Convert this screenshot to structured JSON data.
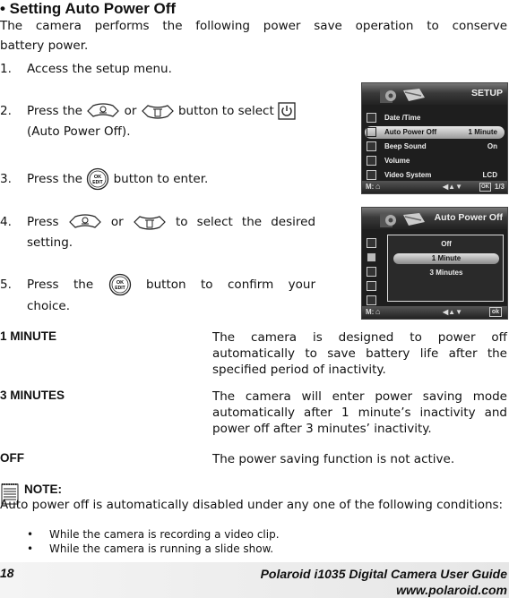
{
  "section": {
    "title": "• Setting Auto Power Off",
    "intro_line1": "The camera performs the following power save operation to conserve",
    "intro_line2": "battery power."
  },
  "steps": [
    {
      "num": "1.",
      "text": "Access the setup menu."
    },
    {
      "num": "2.",
      "text_a": "Press the",
      "text_b": "or",
      "text_c": "button to select",
      "text_d": "(Auto Power Off)."
    },
    {
      "num": "3.",
      "text_a": "Press the",
      "text_b": "button to enter."
    },
    {
      "num": "4.",
      "text_a": "Press",
      "text_b": "or",
      "text_c": "to select the desired",
      "text_d": "setting."
    },
    {
      "num": "5.",
      "text_a": "Press the",
      "text_b": "button to confirm your",
      "text_c": "choice."
    }
  ],
  "icons": {
    "up_button": "self-timer-up-button-icon",
    "down_button": "trash-down-button-icon",
    "power": "power-icon",
    "ok_edit": "ok-edit-button-icon",
    "ok_label": "OK",
    "edit_label": "EDIT"
  },
  "setup_screen": {
    "title": "SETUP",
    "rows": [
      {
        "label": "Date /Time",
        "value": ""
      },
      {
        "label": "Auto Power Off",
        "value": "1 Minute",
        "selected": true
      },
      {
        "label": "Beep Sound",
        "value": "On"
      },
      {
        "label": "Volume",
        "value": ""
      },
      {
        "label": "Video System",
        "value": "LCD"
      }
    ],
    "footer_left": "M:",
    "footer_nav": "◀▲▼",
    "footer_ok": "OK",
    "footer_page": "1/3"
  },
  "apo_screen": {
    "title": "Auto Power Off",
    "options": [
      {
        "label": "Off"
      },
      {
        "label": "1 Minute",
        "selected": true
      },
      {
        "label": "3 Minutes"
      }
    ],
    "footer_left": "M:",
    "footer_nav": "◀▲▼",
    "footer_ok": "ok"
  },
  "definitions": [
    {
      "term": "1 MINUTE",
      "desc": "The camera is designed to power off automatically to save battery life after the specified period of inactivity."
    },
    {
      "term": "3 MINUTES",
      "desc": "The camera will enter power saving mode automatically after 1 minute’s inactivity and power off after 3 minutes’ inactivity."
    },
    {
      "term": "OFF",
      "desc": "The power saving function is not active."
    }
  ],
  "note": {
    "title": "NOTE:",
    "body": "Auto power off is automatically disabled under any one of the following conditions:",
    "bullets": [
      "While the camera is recording a video clip.",
      "While the camera is running a slide show."
    ]
  },
  "footer": {
    "page_number": "18",
    "guide_title": "Polaroid i1035 Digital Camera User Guide",
    "website": "www.polaroid.com"
  }
}
